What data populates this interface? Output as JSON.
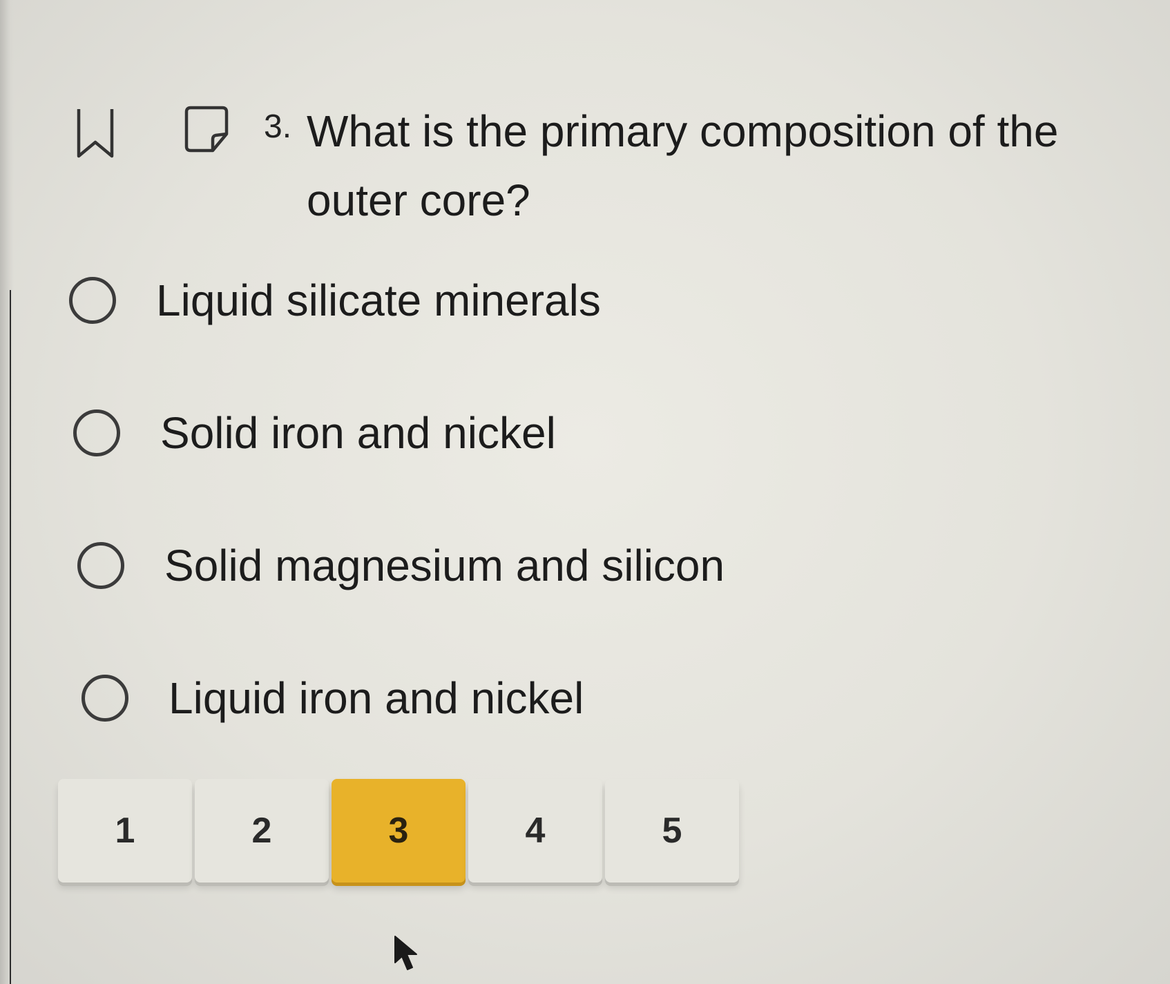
{
  "question": {
    "number": "3.",
    "text": "What is the primary composition of the outer core?"
  },
  "options": [
    {
      "label": "Liquid silicate minerals",
      "selected": false
    },
    {
      "label": "Solid iron and nickel",
      "selected": false
    },
    {
      "label": "Solid magnesium and silicon",
      "selected": false
    },
    {
      "label": "Liquid iron and nickel",
      "selected": false
    }
  ],
  "pagination": {
    "pages": [
      "1",
      "2",
      "3",
      "4",
      "5"
    ],
    "current": "3"
  },
  "colors": {
    "active_page": "#e8b22a",
    "page_button": "#e6e5de",
    "background": "#e8e7e0"
  },
  "icons": {
    "bookmark": "bookmark-icon",
    "note": "note-icon",
    "radio": "radio-icon",
    "cursor": "cursor-arrow-icon"
  }
}
